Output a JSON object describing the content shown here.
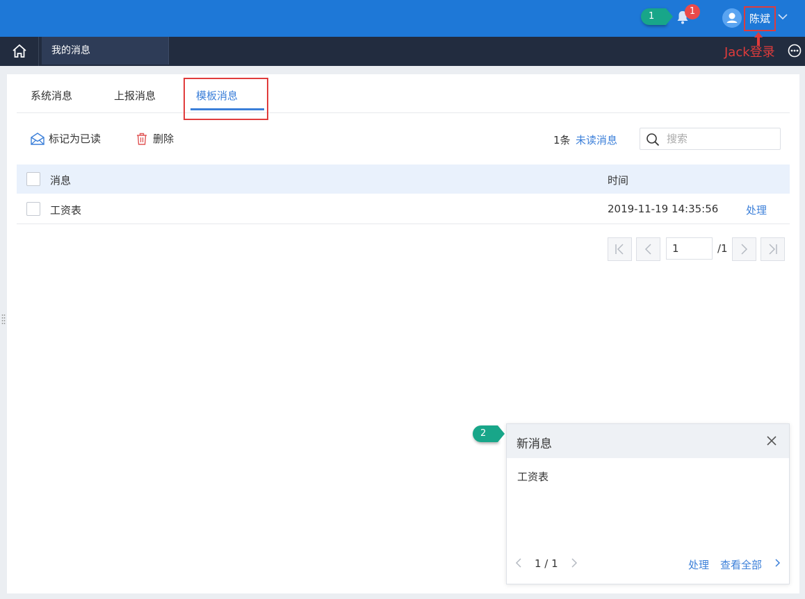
{
  "header": {
    "callout_1": "1",
    "notification_count": "1",
    "username": "陈斌",
    "annotation": "Jack登录"
  },
  "nav": {
    "active_tab": "我的消息"
  },
  "tabs": [
    {
      "label": "系统消息"
    },
    {
      "label": "上报消息"
    },
    {
      "label": "模板消息"
    }
  ],
  "toolbar": {
    "mark_read_label": "标记为已读",
    "delete_label": "删除",
    "count_label": "1条",
    "unread_label": "未读消息",
    "search_placeholder": "搜索"
  },
  "table": {
    "columns": [
      "消息",
      "时间"
    ],
    "rows": [
      {
        "message": "工资表",
        "time": "2019-11-19 14:35:56",
        "action": "处理"
      }
    ]
  },
  "pager": {
    "current_page": "1",
    "total_label": "/1"
  },
  "popup": {
    "callout_2": "2",
    "title": "新消息",
    "body": "工资表",
    "page_indicator": "1 / 1",
    "process_label": "处理",
    "view_all_label": "查看全部"
  },
  "colors": {
    "header_blue": "#1e78d7",
    "nav_dark": "#222c3f",
    "accent": "#3b7fd9",
    "badge_red": "#ea4a4a",
    "annotation_red": "#e03b3b",
    "callout_green": "#18a689"
  }
}
